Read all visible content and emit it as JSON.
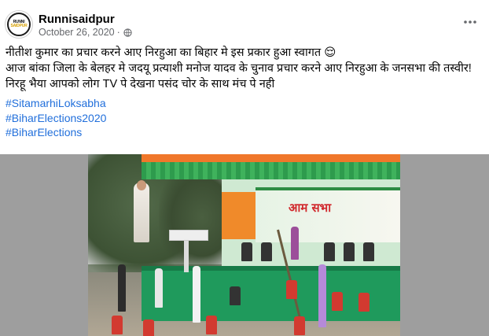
{
  "post": {
    "page_name": "Runnisaidpur",
    "date": "October 26, 2020",
    "separator": "·",
    "avatar_text_top": "RUNNI",
    "avatar_text_bottom": "SAIDPUR",
    "privacy_icon": "globe-icon",
    "more_icon": "more-options-icon",
    "text_lines": [
      "नीतीश कुमार का प्रचार करने आए निरहुआ का बिहार मे इस प्रकार हुआ स्वागत 😌",
      "आज बांका जिला के बेलहर मे जदयू प्रत्याशी मनोज यादव के चुनाव प्रचार करने आए निरहुआ के जनसभा की तस्वीर!",
      "निरहू भैया आपको लोग TV पे देखना पसंद चोर के साथ मंच पे नही"
    ],
    "hashtags": [
      "#SitamarhiLoksabha",
      "#BiharElections2020",
      "#BiharElections"
    ],
    "image_banner_text": "आम सभा"
  },
  "colors": {
    "link": "#216fdb",
    "meta": "#65676b",
    "media_bg": "#9e9e9e"
  }
}
